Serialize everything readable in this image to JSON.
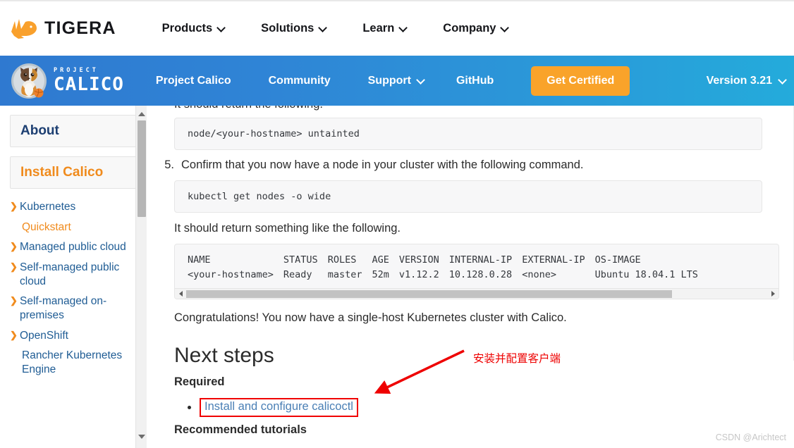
{
  "tigera_bar": {
    "logo_text": "TIGERA",
    "logo_icon": "tigera-tiger-icon",
    "nav": [
      {
        "label": "Products",
        "icon": "chevron-down-icon"
      },
      {
        "label": "Solutions",
        "icon": "chevron-down-icon"
      },
      {
        "label": "Learn",
        "icon": "chevron-down-icon"
      },
      {
        "label": "Company",
        "icon": "chevron-down-icon"
      }
    ]
  },
  "calico_bar": {
    "logo_icon": "calico-cat-icon",
    "logo_kicker": "PROJECT",
    "logo_name": "CALICO",
    "nav": [
      {
        "label": "Project Calico",
        "icon": null
      },
      {
        "label": "Community",
        "icon": null
      },
      {
        "label": "Support",
        "icon": "chevron-down-icon"
      },
      {
        "label": "GitHub",
        "icon": null
      }
    ],
    "cta_label": "Get Certified",
    "cta_color": "#f9a32a",
    "version_label": "Version 3.21",
    "version_icon": "chevron-down-icon",
    "gradient_from": "#2f79d0",
    "gradient_to": "#24abdb"
  },
  "sidebar": {
    "boxes": [
      {
        "label": "About",
        "color": "#1d3f72"
      },
      {
        "label": "Install Calico",
        "color": "#f08b1d"
      }
    ],
    "tree": [
      {
        "label": "Kubernetes",
        "caret": "caret-down-icon",
        "level": 1,
        "active": false
      },
      {
        "label": "Quickstart",
        "caret": null,
        "level": 2,
        "active": true
      },
      {
        "label": "Managed public cloud",
        "caret": "caret-right-icon",
        "level": 2,
        "active": false
      },
      {
        "label": "Self-managed public cloud",
        "caret": "caret-right-icon",
        "level": 2,
        "active": false
      },
      {
        "label": "Self-managed on-premises",
        "caret": "caret-right-icon",
        "level": 2,
        "active": false
      },
      {
        "label": "OpenShift",
        "caret": "caret-right-icon",
        "level": 2,
        "active": false
      },
      {
        "label": "Rancher Kubernetes Engine",
        "caret": null,
        "level": 2,
        "active": false
      }
    ],
    "scrollbar": {
      "up_icon": "scroll-up-arrow-icon",
      "down_icon": "scroll-down-arrow-icon"
    }
  },
  "content": {
    "clipped_top_line": "It should return the following.",
    "code_1": "node/<your-hostname> untainted",
    "step_5_num": "5.",
    "step_5_text": "Confirm that you now have a node in your cluster with the following command.",
    "code_2": "kubectl get nodes -o wide",
    "para_return": "It should return something like the following.",
    "table": {
      "headers": [
        "NAME",
        "STATUS",
        "ROLES",
        "AGE",
        "VERSION",
        "INTERNAL-IP",
        "EXTERNAL-IP",
        "OS-IMAGE"
      ],
      "rows": [
        [
          "<your-hostname>",
          "Ready",
          "master",
          "52m",
          "v1.12.2",
          "10.128.0.28",
          "<none>",
          "Ubuntu 18.04.1 LTS"
        ]
      ],
      "hscroll": {
        "left_icon": "scroll-left-arrow-icon",
        "right_icon": "scroll-right-arrow-icon"
      }
    },
    "congrats": "Congratulations! You now have a single-host Kubernetes cluster with Calico.",
    "next_steps_title": "Next steps",
    "required_label": "Required",
    "required_link": "Install and configure calicoctl",
    "recommended_label": "Recommended tutorials"
  },
  "annotation": {
    "text": "安装并配置客户端",
    "color": "#ee0000",
    "arrow_icon": "red-arrow-icon",
    "highlight_box_color": "#f00000"
  },
  "watermark": "CSDN @Arichtect"
}
